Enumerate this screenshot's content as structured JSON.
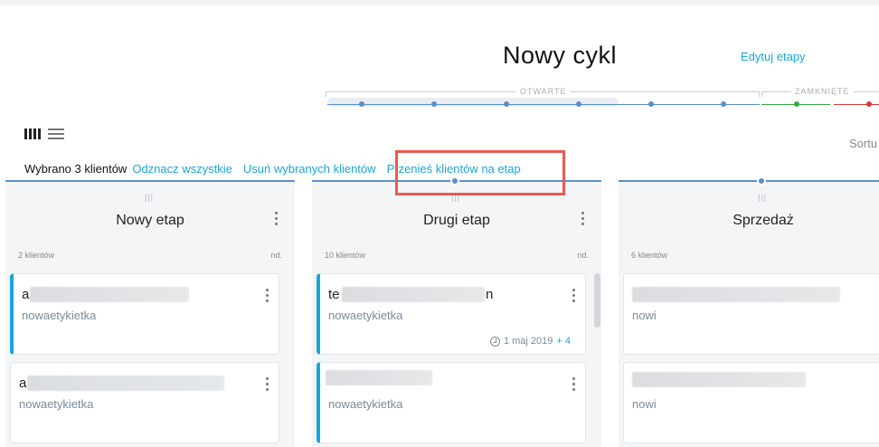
{
  "header": {
    "title": "Nowy cykl",
    "edit_stages": "Edytuj etapy"
  },
  "pipeline": {
    "group_open": "OTWARTE",
    "group_closed": "ZAMKNIĘTE",
    "colors": {
      "open": "#5b8fc7",
      "won": "#2faa4f",
      "lost": "#d9363e"
    }
  },
  "toolbar": {
    "sort_label": "Sortu",
    "view_columns_icon": "columns-icon",
    "view_list_icon": "list-icon"
  },
  "selection": {
    "count_label": "Wybrano 3 klientów",
    "deselect_all": "Odznacz wszystkie",
    "delete_selected": "Usuń wybranych klientów",
    "move_to_stage": "Przenieś klientów na etap"
  },
  "columns": [
    {
      "title": "Nowy etap",
      "count": "2 klientów",
      "nd": "nd.",
      "cards": [
        {
          "name": "a",
          "tag": "nowaetykietka",
          "selected": true
        },
        {
          "name": "a",
          "tag": "nowaetykietka",
          "selected": false
        }
      ]
    },
    {
      "title": "Drugi etap",
      "count": "10 klientów",
      "nd": "nd.",
      "cards": [
        {
          "name": "te",
          "name_end": "n",
          "tag": "nowaetykietka",
          "selected": true,
          "date": "1 maj 2019",
          "extra": "+ 4"
        },
        {
          "name": "",
          "tag": "nowaetykietka",
          "selected": true
        }
      ]
    },
    {
      "title": "Sprzedaż",
      "count": "6 klientów",
      "nd": "",
      "cards": [
        {
          "name": "",
          "tag": "nowi",
          "selected": false
        },
        {
          "name": "",
          "tag": "nowi",
          "selected": false
        }
      ]
    }
  ]
}
